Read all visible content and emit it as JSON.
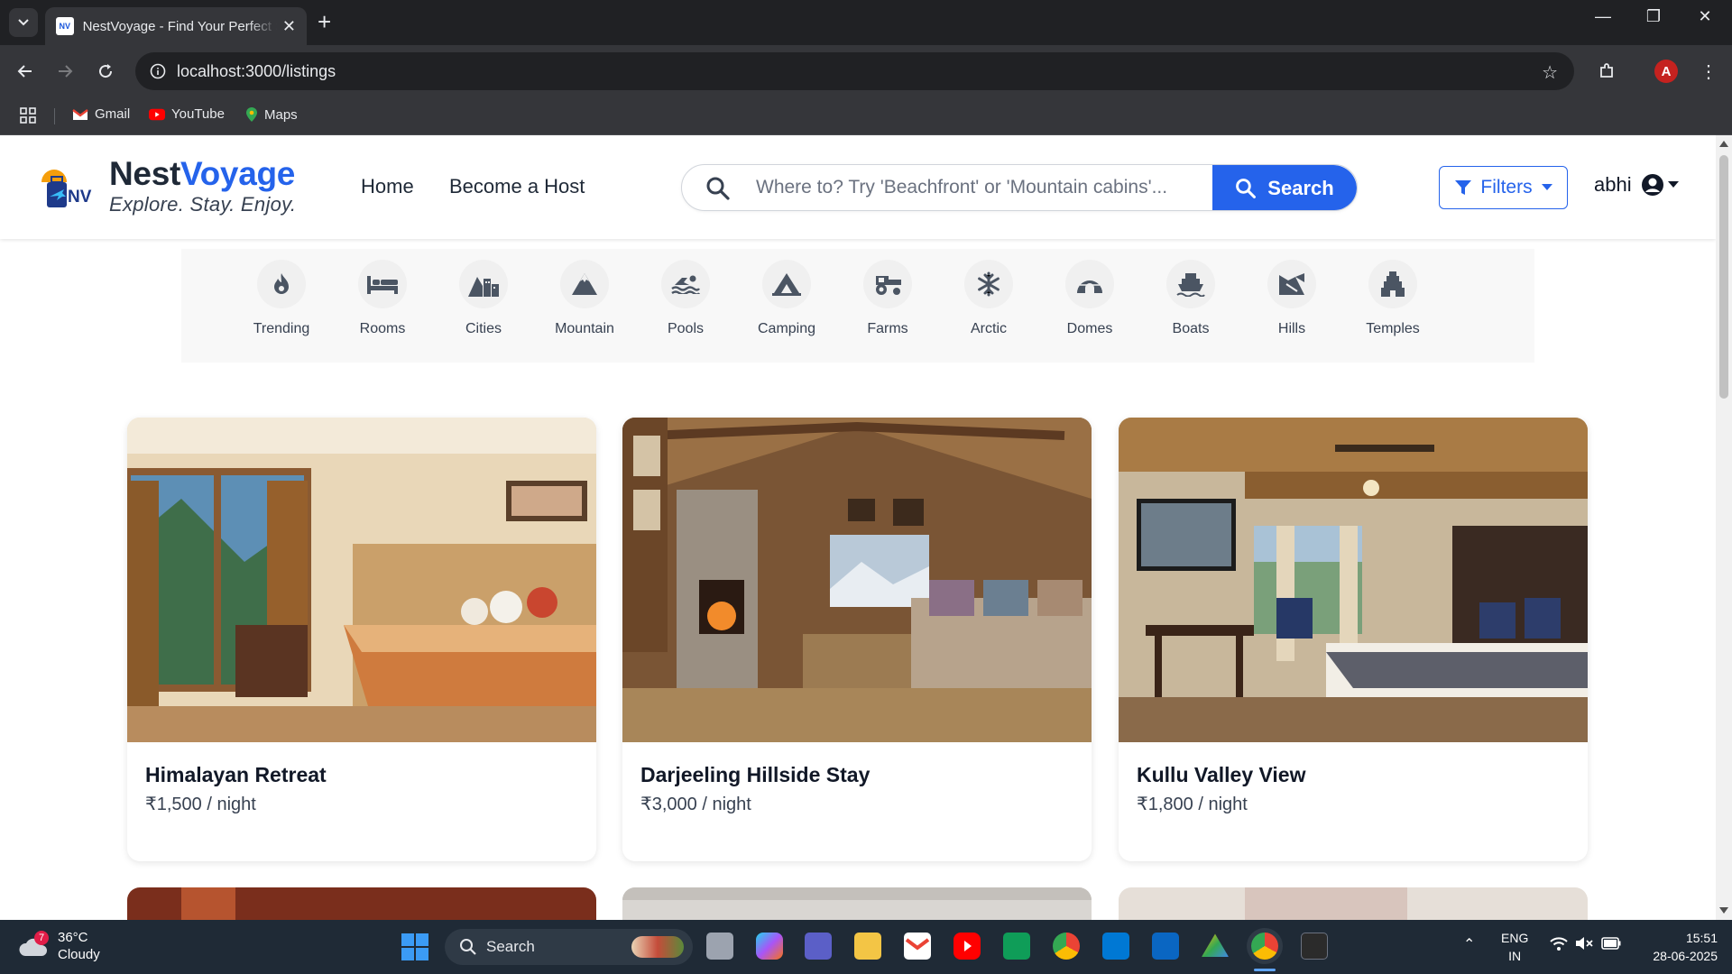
{
  "browser": {
    "tab_title": "NestVoyage - Find Your Perfect Stay",
    "favicon_text": "NV",
    "url": "localhost:3000/listings",
    "bookmarks": [
      {
        "label": "Gmail",
        "color": "#ea4335"
      },
      {
        "label": "YouTube",
        "color": "#ff0000"
      },
      {
        "label": "Maps",
        "color": "#34a853"
      }
    ],
    "profile_initial": "A"
  },
  "site": {
    "brand_first": "Nest",
    "brand_second": "Voyage",
    "tagline": "Explore. Stay. Enjoy.",
    "logo_text": "NV",
    "nav": [
      "Home",
      "Become a Host"
    ],
    "search_placeholder": "Where to? Try 'Beachfront' or 'Mountain cabins'...",
    "search_button": "Search",
    "filters_button": "Filters",
    "username": "abhi",
    "accent_color": "#2563eb"
  },
  "categories": [
    {
      "label": "Trending",
      "icon": "fire-icon"
    },
    {
      "label": "Rooms",
      "icon": "bed-icon"
    },
    {
      "label": "Cities",
      "icon": "mountain-city-icon"
    },
    {
      "label": "Mountain",
      "icon": "mountain-icon"
    },
    {
      "label": "Pools",
      "icon": "swimmer-icon"
    },
    {
      "label": "Camping",
      "icon": "campground-icon"
    },
    {
      "label": "Farms",
      "icon": "tractor-icon"
    },
    {
      "label": "Arctic",
      "icon": "snowflake-icon"
    },
    {
      "label": "Domes",
      "icon": "igloo-icon"
    },
    {
      "label": "Boats",
      "icon": "ship-icon"
    },
    {
      "label": "Hills",
      "icon": "hill-icon"
    },
    {
      "label": "Temples",
      "icon": "gopuram-icon"
    }
  ],
  "listings": [
    {
      "title": "Himalayan Retreat",
      "price": "₹1,500 / night"
    },
    {
      "title": "Darjeeling Hillside Stay",
      "price": "₹3,000 / night"
    },
    {
      "title": "Kullu Valley View",
      "price": "₹1,800 / night"
    }
  ],
  "taskbar": {
    "weather_temp": "36°C",
    "weather_desc": "Cloudy",
    "weather_badge": "7",
    "search_label": "Search",
    "lang_line1": "ENG",
    "lang_line2": "IN",
    "time": "15:51",
    "date": "28-06-2025"
  }
}
